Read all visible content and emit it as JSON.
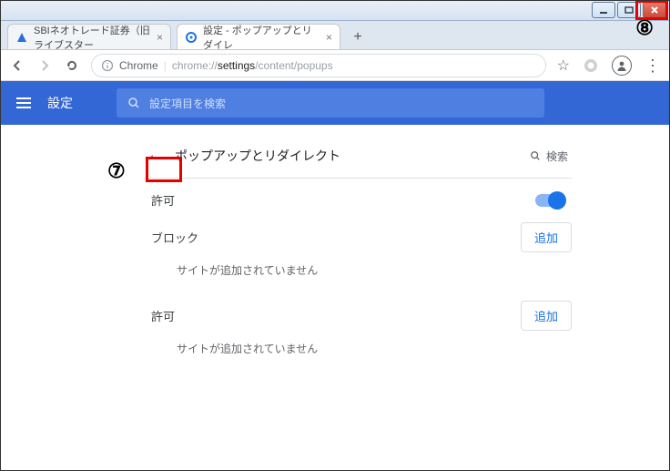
{
  "window": {
    "tabs": [
      {
        "title": "SBIネオトレード証券（旧ライブスター",
        "favicon": "sbi"
      },
      {
        "title": "設定 - ポップアップとリダイレ",
        "favicon": "gear"
      }
    ],
    "newtab_label": "+"
  },
  "addressbar": {
    "scheme_label": "Chrome",
    "url_prefix": "chrome://",
    "url_host": "settings",
    "url_path": "/content/popups"
  },
  "settings_header": {
    "title": "設定",
    "search_placeholder": "設定項目を検索"
  },
  "panel": {
    "back_label": "←",
    "title": "ポップアップとリダイレクト",
    "search_label": "検索",
    "allow_toggle_label": "許可",
    "sections": [
      {
        "label": "ブロック",
        "add_label": "追加",
        "empty_text": "サイトが追加されていません"
      },
      {
        "label": "許可",
        "add_label": "追加",
        "empty_text": "サイトが追加されていません"
      }
    ]
  },
  "annotations": {
    "step7": "7",
    "step8": "8"
  }
}
